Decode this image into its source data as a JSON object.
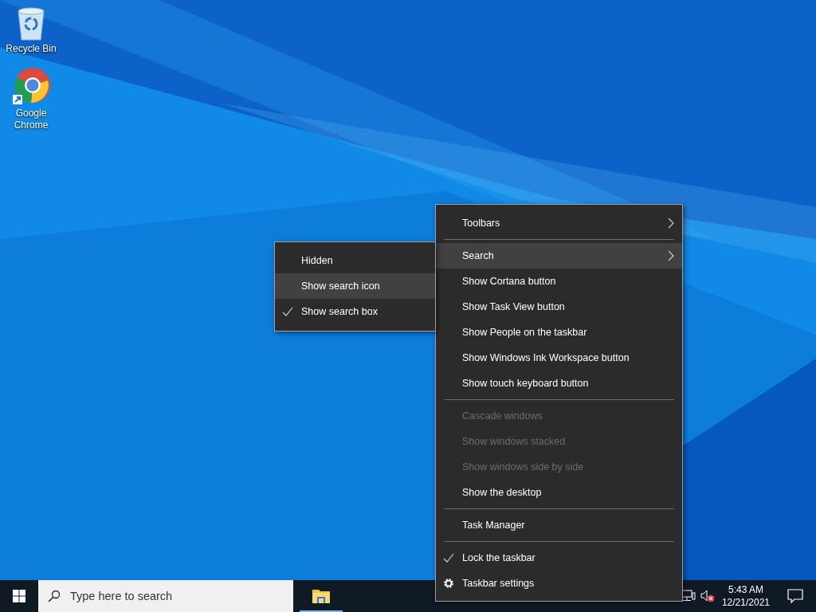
{
  "desktop_icons": [
    {
      "label": "Recycle Bin",
      "kind": "recycle-bin"
    },
    {
      "label": "Google Chrome",
      "kind": "browser"
    }
  ],
  "context_menu": {
    "items": [
      {
        "kind": "submenu",
        "label": "Toolbars",
        "selected": false,
        "checked": false,
        "disabled": false
      },
      {
        "kind": "separator"
      },
      {
        "kind": "submenu",
        "label": "Search",
        "selected": true,
        "checked": false,
        "disabled": false
      },
      {
        "kind": "item",
        "label": "Show Cortana button",
        "selected": false,
        "checked": false,
        "disabled": false
      },
      {
        "kind": "item",
        "label": "Show Task View button",
        "selected": false,
        "checked": false,
        "disabled": false
      },
      {
        "kind": "item",
        "label": "Show People on the taskbar",
        "selected": false,
        "checked": false,
        "disabled": false
      },
      {
        "kind": "item",
        "label": "Show Windows Ink Workspace button",
        "selected": false,
        "checked": false,
        "disabled": false
      },
      {
        "kind": "item",
        "label": "Show touch keyboard button",
        "selected": false,
        "checked": false,
        "disabled": false
      },
      {
        "kind": "separator"
      },
      {
        "kind": "item",
        "label": "Cascade windows",
        "selected": false,
        "checked": false,
        "disabled": true
      },
      {
        "kind": "item",
        "label": "Show windows stacked",
        "selected": false,
        "checked": false,
        "disabled": true
      },
      {
        "kind": "item",
        "label": "Show windows side by side",
        "selected": false,
        "checked": false,
        "disabled": true
      },
      {
        "kind": "item",
        "label": "Show the desktop",
        "selected": false,
        "checked": false,
        "disabled": false
      },
      {
        "kind": "separator"
      },
      {
        "kind": "item",
        "label": "Task Manager",
        "selected": false,
        "checked": false,
        "disabled": false
      },
      {
        "kind": "separator"
      },
      {
        "kind": "item",
        "label": "Lock the taskbar",
        "selected": false,
        "checked": true,
        "disabled": false
      },
      {
        "kind": "settings",
        "label": "Taskbar settings",
        "selected": false,
        "checked": false,
        "disabled": false
      }
    ]
  },
  "search_submenu": {
    "items": [
      {
        "kind": "item",
        "label": "Hidden",
        "selected": false,
        "checked": false,
        "disabled": false
      },
      {
        "kind": "item",
        "label": "Show search icon",
        "selected": true,
        "checked": false,
        "disabled": false
      },
      {
        "kind": "item",
        "label": "Show search box",
        "selected": false,
        "checked": true,
        "disabled": false
      }
    ]
  },
  "taskbar": {
    "search": {
      "placeholder": "Type here to search"
    },
    "tray": {
      "volume_muted": true,
      "time": "5:43 AM",
      "date": "12/21/2021"
    }
  }
}
